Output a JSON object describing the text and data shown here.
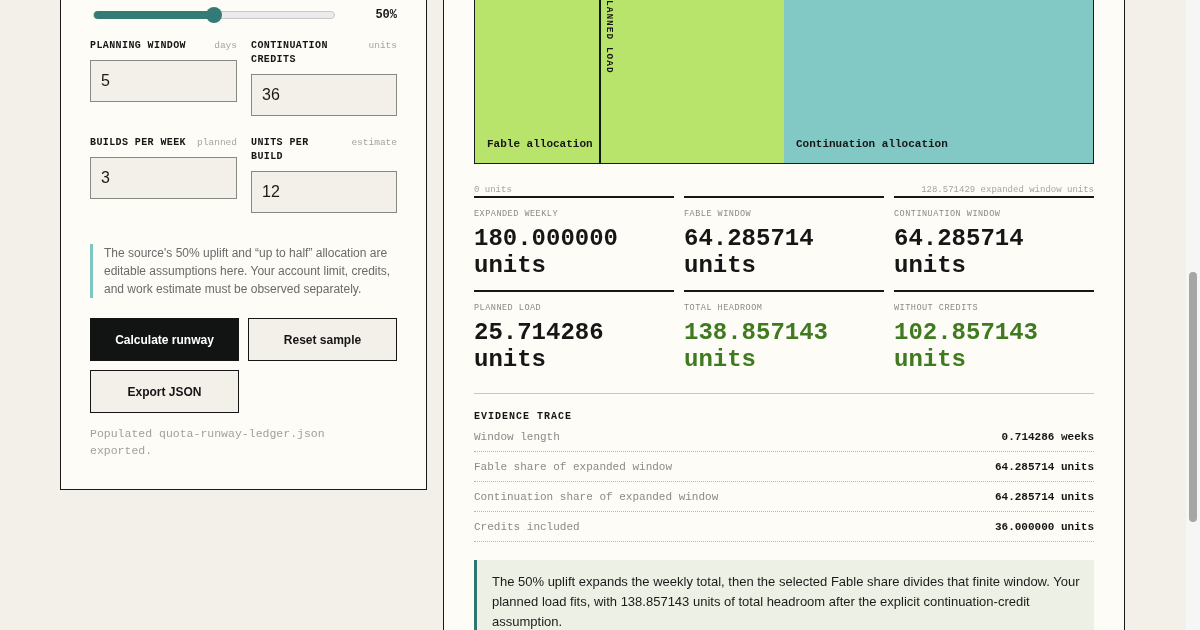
{
  "controls": {
    "slider": {
      "level": 0.5,
      "reading": "50%"
    },
    "fields": [
      {
        "label": "PLANNING WINDOW",
        "hint": "days",
        "value": "5"
      },
      {
        "label": "CONTINUATION CREDITS",
        "hint": "units",
        "value": "36"
      },
      {
        "label": "BUILDS PER WEEK",
        "hint": "planned",
        "value": "3"
      },
      {
        "label": "UNITS PER BUILD",
        "hint": "estimate",
        "value": "12"
      }
    ],
    "note": "The source's 50% uplift and “up to half” allocation are editable assumptions here. Your account limit, credits, and work estimate must be observed separately.",
    "buttons": [
      {
        "label": "Calculate runway",
        "kind": "primary"
      },
      {
        "label": "Reset sample",
        "kind": "secondary"
      },
      {
        "label": "Export JSON",
        "kind": "secondary"
      }
    ],
    "status": "Populated quota-runway-ledger.json exported."
  },
  "allocation": {
    "segments": [
      {
        "label": "Fable allocation",
        "level": 0.5,
        "color": "#b9e46c"
      },
      {
        "label": "Continuation allocation",
        "level": 0.5,
        "color": "#82c8c4"
      }
    ],
    "marker": {
      "label": "LANNED LOAD",
      "level": 0.2
    },
    "axis_start": "0 units",
    "axis_end": "128.571429 expanded window units"
  },
  "metrics": [
    {
      "label": "EXPANDED WEEKLY",
      "value": "180.000000 units",
      "kind": "plain"
    },
    {
      "label": "FABLE WINDOW",
      "value": "64.285714 units",
      "kind": "plain"
    },
    {
      "label": "CONTINUATION WINDOW",
      "value": "64.285714 units",
      "kind": "plain"
    },
    {
      "label": "PLANNED LOAD",
      "value": "25.714286 units",
      "kind": "plain"
    },
    {
      "label": "TOTAL HEADROOM",
      "value": "138.857143 units",
      "kind": "good"
    },
    {
      "label": "WITHOUT CREDITS",
      "value": "102.857143 units",
      "kind": "good"
    }
  ],
  "evidence": {
    "title": "EVIDENCE TRACE",
    "rows": [
      {
        "label": "Window length",
        "value": "0.714286 weeks"
      },
      {
        "label": "Fable share of expanded window",
        "value": "64.285714 units"
      },
      {
        "label": "Continuation share of expanded window",
        "value": "64.285714 units"
      },
      {
        "label": "Credits included",
        "value": "36.000000 units"
      }
    ]
  },
  "summary": "The 50% uplift expands the weekly total, then the selected Fable share divides that finite window. Your planned load fits, with 138.857143 units of total headroom after the explicit continuation-credit assumption."
}
